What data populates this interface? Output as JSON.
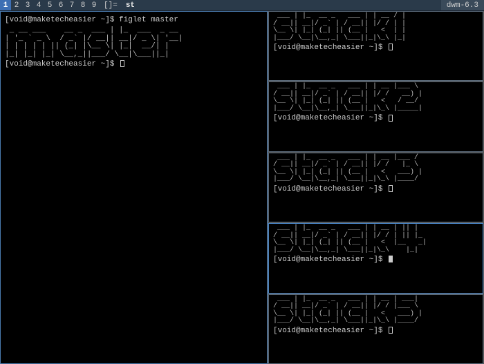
{
  "statusbar": {
    "tags": [
      "1",
      "2",
      "3",
      "4",
      "5",
      "6",
      "7",
      "8",
      "9"
    ],
    "active_tag_index": 0,
    "layout_symbol": "[]=",
    "title": "st",
    "wm_name": "dwm-6.3"
  },
  "master": {
    "prompt_top": "[void@maketecheasier ~]$ figlet master",
    "ascii": " _ __ ___    __ _  ___ | |_  ___  _ __ \n| '_ ` _ \\  / _` |/ __|| __|/ _ \\| '__|\n| | | | | || (_| |\\__ \\| |_|  __/| |   \n|_| |_| |_| \\__,_||___/ \\__|\\___||_|   ",
    "prompt_bottom": "[void@maketecheasier ~]$"
  },
  "stacks": [
    {
      "ascii": " ___ | |_  __ _   ___ | | __ / |\n/ __|| __|/ _` | / __|| |/ / | |\n\\__ \\| |_| (_| || (__ |   <  | |\n|___/ \\__|\\__,_| \\___||_|\\_\\ |_|",
      "prompt": "[void@maketecheasier ~]$",
      "focused": false
    },
    {
      "ascii": " ___ | |_  __ _   ___ | | __ |___ \\ \n/ __|| __|/ _` | / __|| |/ /   __) |\n\\__ \\| |_| (_| || (__ |   <   / __/ \n|___/ \\__|\\__,_| \\___||_|\\_\\ |_____|",
      "prompt": "[void@maketecheasier ~]$",
      "focused": false
    },
    {
      "ascii": " ___ | |_  __ _   ___ | | __ |___ / \n/ __|| __|/ _` | / __|| |/ /   |_ \\ \n\\__ \\| |_| (_| || (__ |   <   ___) |\n|___/ \\__|\\__,_| \\___||_|\\_\\ |____/ ",
      "prompt": "[void@maketecheasier ~]$",
      "focused": false
    },
    {
      "ascii": " ___ | |_  __ _   ___ | | __ | || |  \n/ __|| __|/ _` | / __|| |/ / | || |_ \n\\__ \\| |_| (_| || (__ |   <  |__   _|\n|___/ \\__|\\__,_| \\___||_|\\_\\    |_|  ",
      "prompt": "[void@maketecheasier ~]$",
      "focused": true
    },
    {
      "ascii": " ___ | |_  __ _   ___ | | __ | ___| \n/ __|| __|/ _` | / __|| |/ / |___ \\ \n\\__ \\| |_| (_| || (__ |   <   ___) |\n|___/ \\__|\\__,_| \\___||_|\\_\\ |____/ ",
      "prompt": "[void@maketecheasier ~]$",
      "focused": false
    }
  ]
}
